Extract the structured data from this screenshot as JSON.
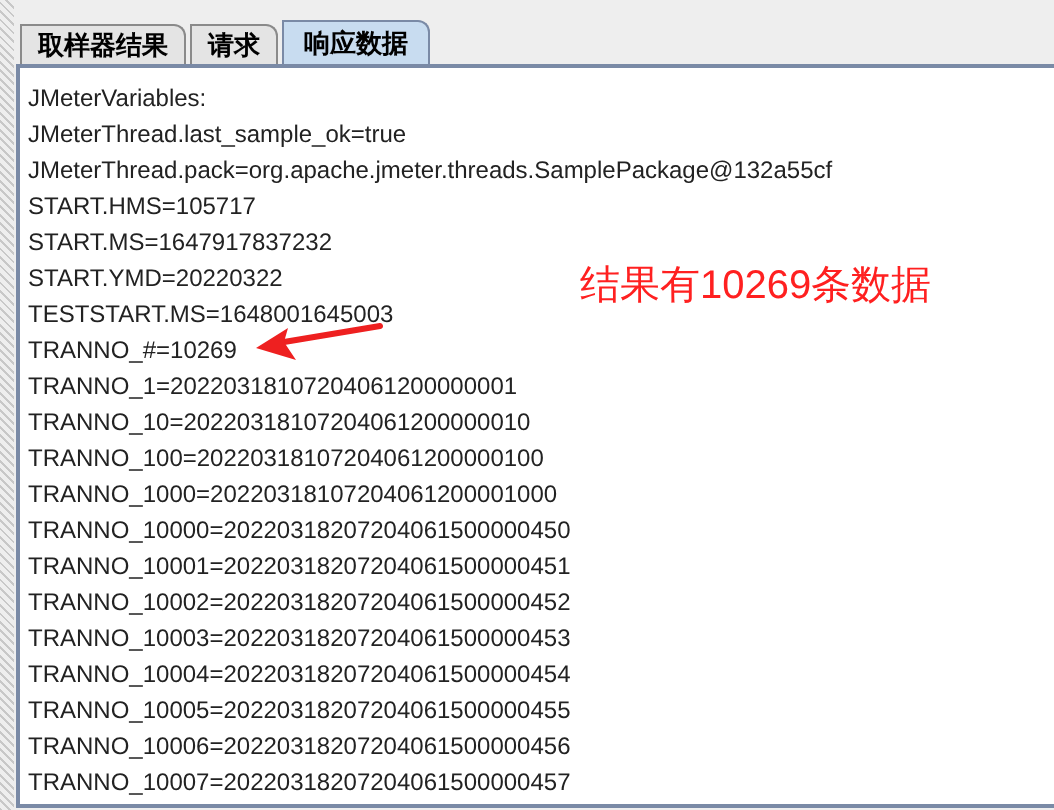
{
  "tabs": [
    {
      "label": "取样器结果",
      "selected": false
    },
    {
      "label": "请求",
      "selected": false
    },
    {
      "label": "响应数据",
      "selected": true
    }
  ],
  "response_lines": [
    "JMeterVariables:",
    "JMeterThread.last_sample_ok=true",
    "JMeterThread.pack=org.apache.jmeter.threads.SamplePackage@132a55cf",
    "START.HMS=105717",
    "START.MS=1647917837232",
    "START.YMD=20220322",
    "TESTSTART.MS=1648001645003",
    "TRANNO_#=10269",
    "TRANNO_1=20220318107204061200000001",
    "TRANNO_10=20220318107204061200000010",
    "TRANNO_100=20220318107204061200000100",
    "TRANNO_1000=20220318107204061200001000",
    "TRANNO_10000=20220318207204061500000450",
    "TRANNO_10001=20220318207204061500000451",
    "TRANNO_10002=20220318207204061500000452",
    "TRANNO_10003=20220318207204061500000453",
    "TRANNO_10004=20220318207204061500000454",
    "TRANNO_10005=20220318207204061500000455",
    "TRANNO_10006=20220318207204061500000456",
    "TRANNO_10007=20220318207204061500000457"
  ],
  "annotation": {
    "text": "结果有10269条数据"
  }
}
